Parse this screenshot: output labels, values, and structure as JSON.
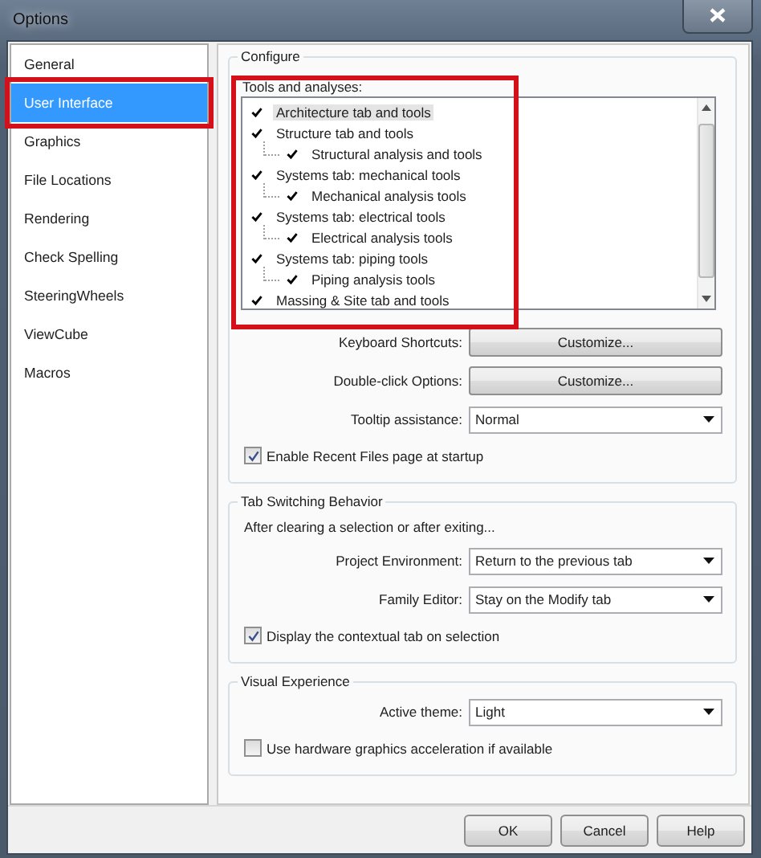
{
  "window": {
    "title": "Options"
  },
  "sidebar": {
    "items": [
      {
        "label": "General",
        "selected": false,
        "highlighted": false
      },
      {
        "label": "User Interface",
        "selected": true,
        "highlighted": true
      },
      {
        "label": "Graphics",
        "selected": false,
        "highlighted": false
      },
      {
        "label": "File Locations",
        "selected": false,
        "highlighted": false
      },
      {
        "label": "Rendering",
        "selected": false,
        "highlighted": false
      },
      {
        "label": "Check Spelling",
        "selected": false,
        "highlighted": false
      },
      {
        "label": "SteeringWheels",
        "selected": false,
        "highlighted": false
      },
      {
        "label": "ViewCube",
        "selected": false,
        "highlighted": false
      },
      {
        "label": "Macros",
        "selected": false,
        "highlighted": false
      }
    ]
  },
  "configure": {
    "title": "Configure",
    "tools_label": "Tools and analyses:",
    "tools_highlighted": true,
    "tools": [
      {
        "label": "Architecture tab and tools",
        "checked": true,
        "focused": true
      },
      {
        "label": "Structure tab and tools",
        "checked": true,
        "focused": false,
        "children": [
          {
            "label": "Structural analysis and tools",
            "checked": true,
            "focused": false
          }
        ]
      },
      {
        "label": "Systems tab: mechanical tools",
        "checked": true,
        "focused": false,
        "children": [
          {
            "label": "Mechanical analysis tools",
            "checked": true,
            "focused": false
          }
        ]
      },
      {
        "label": "Systems tab: electrical tools",
        "checked": true,
        "focused": false,
        "children": [
          {
            "label": "Electrical analysis tools",
            "checked": true,
            "focused": false
          }
        ]
      },
      {
        "label": "Systems tab: piping tools",
        "checked": true,
        "focused": false,
        "children": [
          {
            "label": "Piping analysis tools",
            "checked": true,
            "focused": false
          }
        ]
      },
      {
        "label": "Massing & Site tab and tools",
        "checked": true,
        "focused": false
      }
    ],
    "rows": [
      {
        "kind": "button",
        "label": "Keyboard Shortcuts:",
        "value": "Customize..."
      },
      {
        "kind": "button",
        "label": "Double-click Options:",
        "value": "Customize..."
      },
      {
        "kind": "combo",
        "label": "Tooltip assistance:",
        "value": "Normal"
      },
      {
        "kind": "check",
        "label": "Enable Recent Files page at startup",
        "checked": true
      }
    ]
  },
  "tab_switching": {
    "title": "Tab Switching Behavior",
    "rows": [
      {
        "kind": "text",
        "label": "After clearing a selection or after exiting..."
      },
      {
        "kind": "combo",
        "label": "Project Environment:",
        "value": "Return to the previous tab"
      },
      {
        "kind": "combo",
        "label": "Family Editor:",
        "value": "Stay on the Modify tab"
      },
      {
        "kind": "check",
        "label": "Display the contextual tab on selection",
        "checked": true
      }
    ]
  },
  "visual_experience": {
    "title": "Visual Experience",
    "rows": [
      {
        "kind": "combo",
        "label": "Active theme:",
        "value": "Light"
      },
      {
        "kind": "check",
        "label": "Use hardware graphics acceleration if available",
        "checked": false
      }
    ]
  },
  "buttons": [
    {
      "label": "OK"
    },
    {
      "label": "Cancel"
    },
    {
      "label": "Help"
    }
  ]
}
